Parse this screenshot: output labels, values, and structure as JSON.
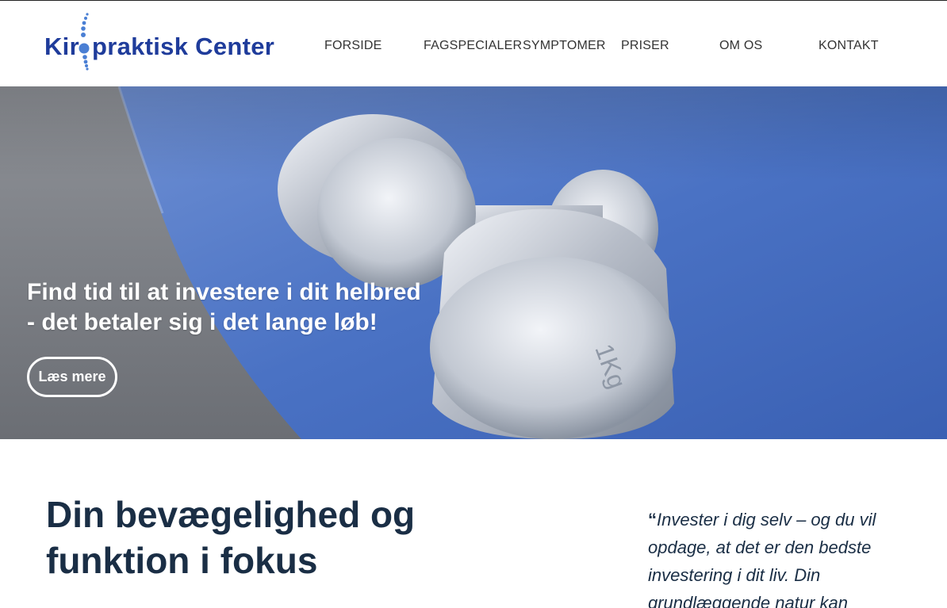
{
  "logo": {
    "text_before": "Kir",
    "text_after": "praktisk Center",
    "brand_color": "#1f3c9b",
    "accent_color": "#4a7fd4"
  },
  "nav": {
    "items": [
      {
        "label": "FORSIDE"
      },
      {
        "label": "FAGSPECIALER"
      },
      {
        "label": "SYMPTOMER"
      },
      {
        "label": "PRISER"
      },
      {
        "label": "OM OS"
      },
      {
        "label": "KONTAKT"
      }
    ]
  },
  "hero": {
    "title_line1": "Find tid til at investere i dit helbred",
    "title_line2": "- det betaler sig i det lange løb!",
    "button_label": "Læs mere",
    "dumbbell_label": "1Kg"
  },
  "main": {
    "heading_line1": "Din bevægelighed og",
    "heading_line2": "funktion i fokus",
    "quote_mark": "“",
    "quote_text": "Invester i dig selv – og du vil opdage, at det er den bedste investering i dit liv. Din grundlæggende natur kan"
  },
  "colors": {
    "heading": "#1a2e45",
    "mat_blue": "#4a72c4",
    "text_dark": "#333333"
  }
}
